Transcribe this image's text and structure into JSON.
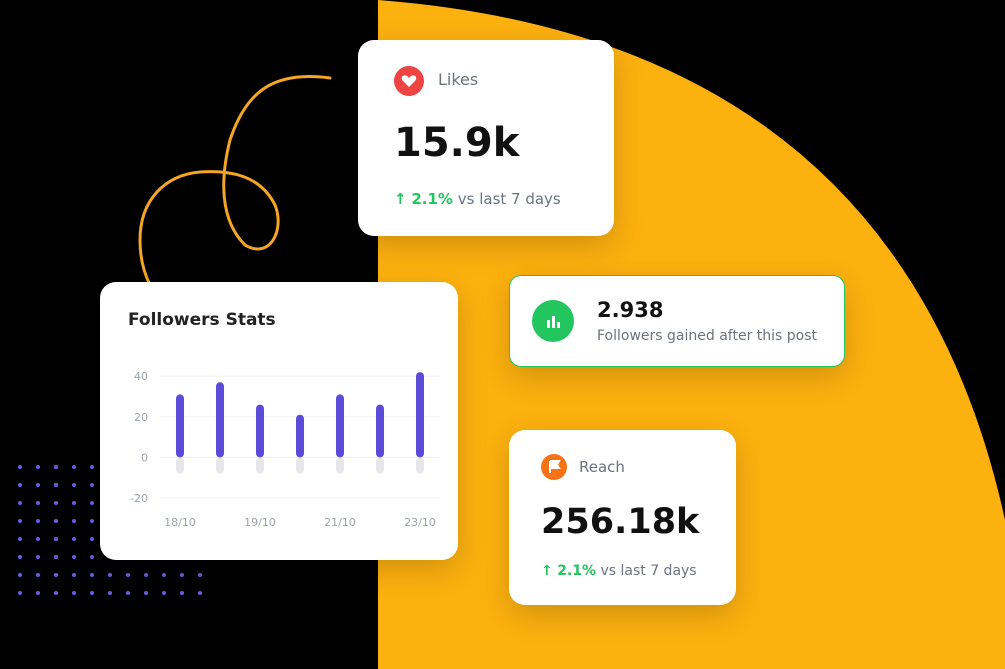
{
  "colors": {
    "accent": "#FDB10F",
    "purple": "#5B4BD6",
    "green": "#22C55E",
    "red": "#EF4444",
    "orange": "#F97316",
    "grayBar": "#E5E7EB"
  },
  "likes": {
    "label": "Likes",
    "value": "15.9k",
    "change": "2.1%",
    "period": "vs last 7 days",
    "icon": "heart-icon"
  },
  "followers_gained": {
    "value": "2.938",
    "label": "Followers gained after this post",
    "icon": "bar-chart-icon"
  },
  "reach": {
    "label": "Reach",
    "value": "256.18k",
    "change": "2.1%",
    "period": "vs last 7 days",
    "icon": "flag-icon"
  },
  "followers_stats": {
    "title": "Followers Stats"
  },
  "chart_data": {
    "type": "bar",
    "title": "Followers Stats",
    "categories": [
      "18/10",
      "",
      "19/10",
      "",
      "21/10",
      "",
      "23/10"
    ],
    "x_tick_labels": [
      "18/10",
      "19/10",
      "21/10",
      "23/10"
    ],
    "series": [
      {
        "values": [
          31,
          37,
          26,
          21,
          31,
          26,
          42
        ]
      },
      {
        "values": [
          -8,
          -8,
          -8,
          -8,
          -8,
          -8,
          -8
        ]
      }
    ],
    "yticks": [
      "40",
      "20",
      "0",
      "-20"
    ],
    "ylim": [
      -20,
      45
    ],
    "grid": true
  }
}
